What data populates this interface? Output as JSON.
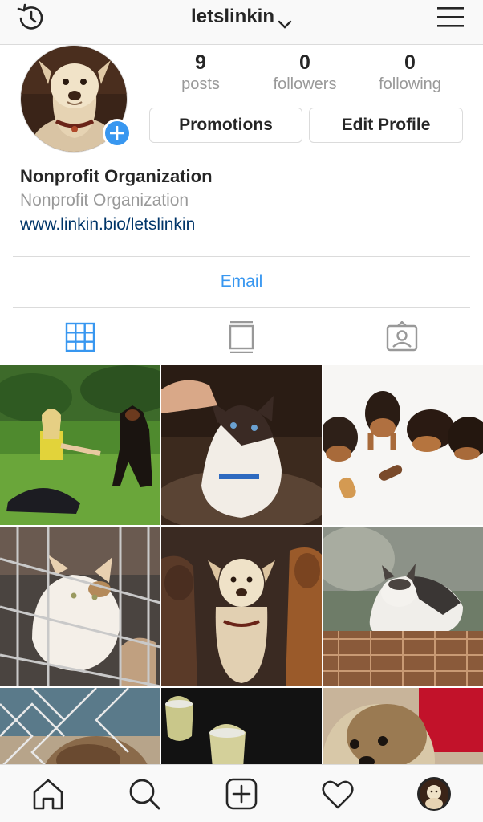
{
  "header": {
    "username": "letslinkin",
    "left_icon": "history-icon",
    "menu_icon": "hamburger-menu-icon"
  },
  "profile": {
    "avatar": "dog-avatar",
    "stats": [
      {
        "value": "9",
        "label": "posts"
      },
      {
        "value": "0",
        "label": "followers"
      },
      {
        "value": "0",
        "label": "following"
      }
    ],
    "promotions_label": "Promotions",
    "edit_label": "Edit Profile",
    "name": "Nonprofit Organization",
    "category": "Nonprofit Organization",
    "website": "www.linkin.bio/letslinkin",
    "contact_label": "Email"
  },
  "tabs": [
    {
      "icon": "grid-icon",
      "active": true
    },
    {
      "icon": "feed-icon",
      "active": false
    },
    {
      "icon": "tagged-icon",
      "active": false
    }
  ],
  "posts": [
    {
      "subject": "woman-with-doberman"
    },
    {
      "subject": "cat-with-hand"
    },
    {
      "subject": "puppies-with-treats"
    },
    {
      "subject": "cat-in-cage"
    },
    {
      "subject": "three-dogs"
    },
    {
      "subject": "cat-on-crate"
    },
    {
      "subject": "dog-behind-fence"
    },
    {
      "subject": "wine-glasses"
    },
    {
      "subject": "yorkie-closeup"
    }
  ],
  "bottom_nav": [
    {
      "icon": "home-icon"
    },
    {
      "icon": "search-icon"
    },
    {
      "icon": "new-post-icon"
    },
    {
      "icon": "activity-heart-icon"
    },
    {
      "icon": "profile-avatar-icon"
    }
  ],
  "colors": {
    "accent": "#3897f0",
    "text": "#262626",
    "muted": "#999999",
    "link": "#003569",
    "border": "#dbdbdb"
  }
}
